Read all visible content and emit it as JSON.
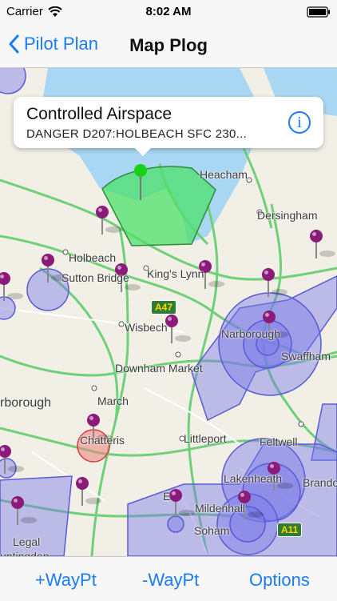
{
  "status_bar": {
    "carrier": "Carrier",
    "time": "8:02 AM"
  },
  "nav": {
    "back_label": "Pilot Plan",
    "title": "Map Plog"
  },
  "callout": {
    "title": "Controlled Airspace",
    "subtitle": "DANGER D207:HOLBEACH SFC 230..."
  },
  "places": {
    "heacham": "Heacham",
    "dersingham": "Dersingham",
    "holbeach": "Holbeach",
    "sutton_bridge": "Sutton Bridge",
    "kings_lynn": "King's Lynn",
    "wisbech": "Wisbech",
    "narborough": "Narborough",
    "swaffham": "Swaffham",
    "downham_market": "Downham Market",
    "march": "March",
    "chatteris": "Chatteris",
    "littleport": "Littleport",
    "feltwell": "Feltwell",
    "lakenheath": "Lakenheath",
    "brandon": "Brando",
    "mildenhall": "Mildenhall",
    "soham": "Soham",
    "ely": "E",
    "peterborough": "rborough",
    "legal": "Legal",
    "huntingdon": "untingdon"
  },
  "road_shields": {
    "a47": "A47",
    "a11": "A11"
  },
  "toolbar": {
    "add_waypoint": "+WayPt",
    "remove_waypoint": "-WayPt",
    "options": "Options"
  },
  "colors": {
    "accent": "#1a7cf5",
    "airspace": "#7b7be8",
    "danger": "#4ce06a",
    "pin": "#8b1a7a"
  }
}
